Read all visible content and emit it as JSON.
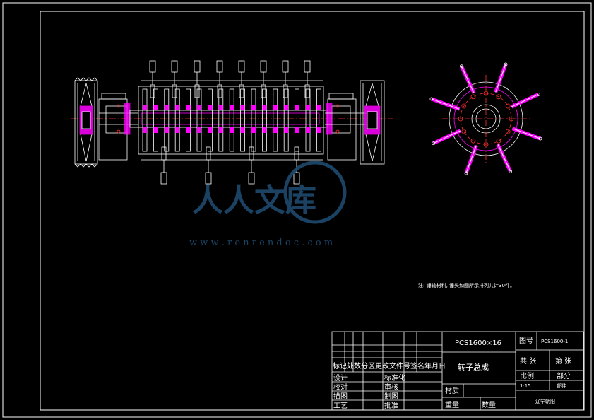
{
  "drawing": {
    "note": "注: 锤轴材料, 锤头如图所示排列共计30件。",
    "watermark": {
      "brand": "人人文库",
      "url": "w w w . r e n r e n d o c . c o m"
    }
  },
  "title_block": {
    "model": "PCS1600×16",
    "drawing_name": "转子总成",
    "drawing_no_label": "图号",
    "drawing_no": "PCS1600-1",
    "sheets_total_label": "共 张",
    "sheet_label": "第 张",
    "scale_label": "比例",
    "part_label": "部分",
    "scale_value": "1:15",
    "part_value": "部件",
    "material_label": "材质",
    "weight_label": "重量",
    "quantity_label": "数量",
    "company": "辽宁朝阳",
    "revision_header": "标记处数分区更改文件号签名年月日",
    "roles": [
      {
        "left": "设计",
        "right": "标准化"
      },
      {
        "left": "校对",
        "right": "审核"
      },
      {
        "left": "描图",
        "right": "制图"
      },
      {
        "left": "工艺",
        "right": "批准"
      }
    ]
  },
  "colors": {
    "line": "#ffffff",
    "magenta": "#ff00ff",
    "red": "#ff3030",
    "watermark": "#1e4a6e"
  }
}
